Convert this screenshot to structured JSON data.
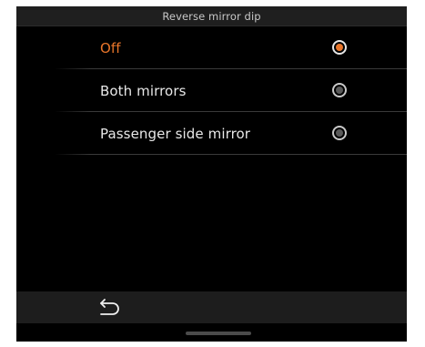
{
  "header": {
    "title": "Reverse mirror dip"
  },
  "options": [
    {
      "label": "Off",
      "selected": true
    },
    {
      "label": "Both mirrors",
      "selected": false
    },
    {
      "label": "Passenger side mirror",
      "selected": false
    }
  ],
  "footer": {
    "back_icon": "back-arrow-icon"
  },
  "colors": {
    "accent": "#e8752a",
    "background": "#000000",
    "header_bg": "#1f1f1f",
    "footer_bg": "#1d1d1d",
    "text": "#e8e8e8"
  }
}
